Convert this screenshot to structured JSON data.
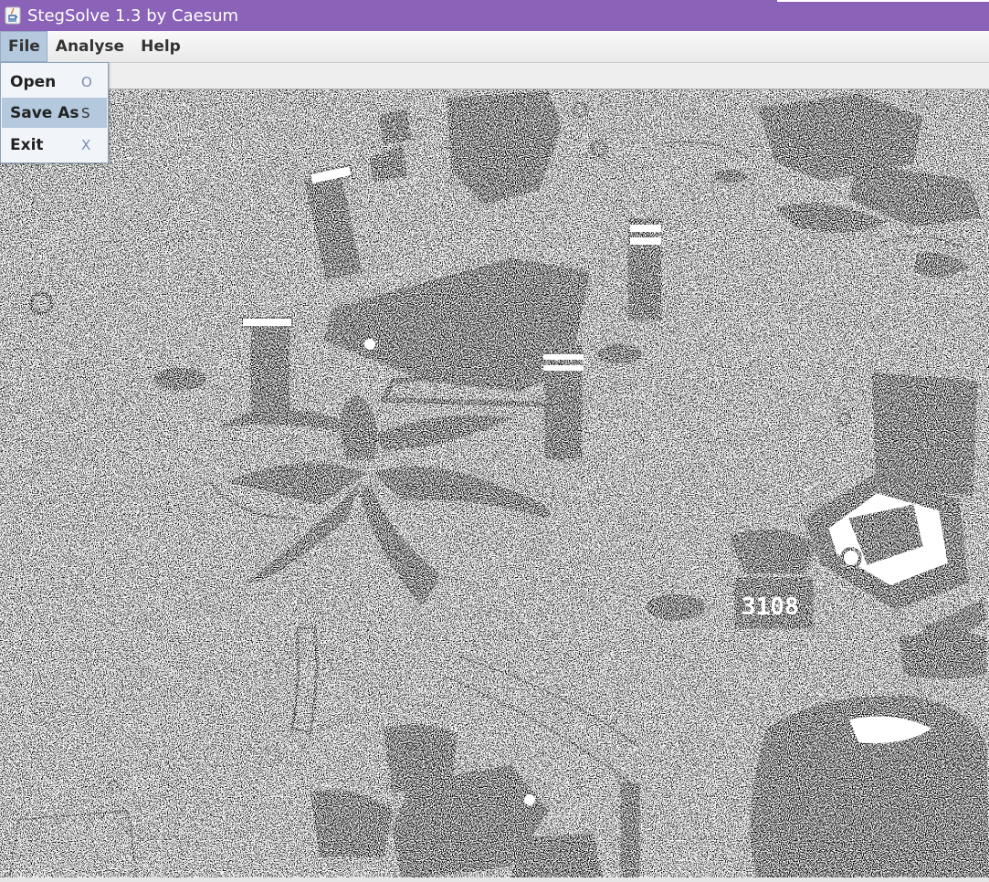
{
  "window": {
    "title": "StegSolve 1.3 by Caesum",
    "icon": "java-coffee-cup-icon",
    "titlebar_color": "#8a63b8"
  },
  "menubar": {
    "items": [
      {
        "label": "File",
        "active": true
      },
      {
        "label": "Analyse",
        "active": false
      },
      {
        "label": "Help",
        "active": false
      }
    ]
  },
  "file_menu": {
    "items": [
      {
        "label": "Open",
        "accelerator": "O",
        "selected": false
      },
      {
        "label": "Save As",
        "accelerator": "S",
        "selected": true
      },
      {
        "label": "Exit",
        "accelerator": "X",
        "selected": false
      }
    ],
    "highlight_color": "#b4c8de"
  },
  "canvas": {
    "content": "bit-plane-image",
    "colors": [
      "#000000",
      "#ffffff"
    ],
    "plates": [
      "3108"
    ]
  }
}
